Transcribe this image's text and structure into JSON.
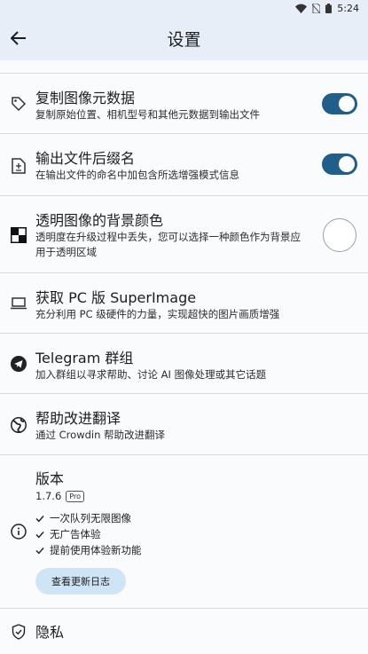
{
  "status": {
    "time": "5:24"
  },
  "header": {
    "title": "设置"
  },
  "items": [
    {
      "title": "复制图像元数据",
      "desc": "复制原始位置、相机型号和其他元数据到输出文件",
      "toggle": "on"
    },
    {
      "title": "输出文件后缀名",
      "desc": "在输出文件的命名中加包含所选增强模式信息",
      "toggle": "on"
    },
    {
      "title": "透明图像的背景颜色",
      "desc": "透明度在升级过程中丢失，您可以选择一种颜色作为背景应用于透明区域"
    },
    {
      "title": "获取 PC 版 SuperImage",
      "desc": "充分利用 PC 级硬件的力量，实现超快的图片画质增强"
    },
    {
      "title": "Telegram 群组",
      "desc": "加入群组以寻求帮助、讨论 AI 图像处理或其它话题"
    },
    {
      "title": "帮助改进翻译",
      "desc": "通过 Crowdin 帮助改进翻译"
    }
  ],
  "version": {
    "title": "版本",
    "number": "1.7.6",
    "badge": "Pro",
    "features": [
      "一次队列无限图像",
      "无广告体验",
      "提前使用体验新功能"
    ],
    "changelog_button": "查看更新日志"
  },
  "privacy": {
    "title": "隐私"
  },
  "colors": {
    "accent": "#1f5f89",
    "chip": "#cfe4f5",
    "appbar": "#e8eef7"
  }
}
